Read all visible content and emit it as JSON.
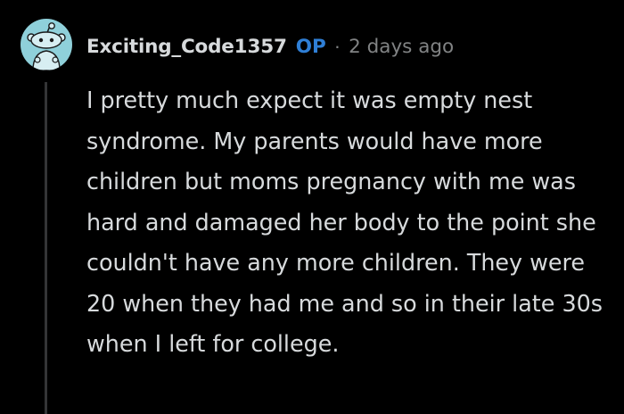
{
  "comment": {
    "avatar": {
      "icon": "snoo-avatar-icon",
      "background_color": "#8fd0da"
    },
    "author": "Exciting_Code1357",
    "badge": "OP",
    "separator": "·",
    "timestamp": "2 days ago",
    "body": "I pretty much expect it was empty nest syndrome. My parents would have more children but moms pregnancy with me was hard and damaged her body to the point she couldn't have any more children. They were 20 when they had me and so in their late 30s when I left for college."
  },
  "colors": {
    "background": "#000000",
    "text": "#d7dadc",
    "op_badge": "#2f7fd6",
    "muted": "#818384",
    "thread_line": "#343536"
  }
}
